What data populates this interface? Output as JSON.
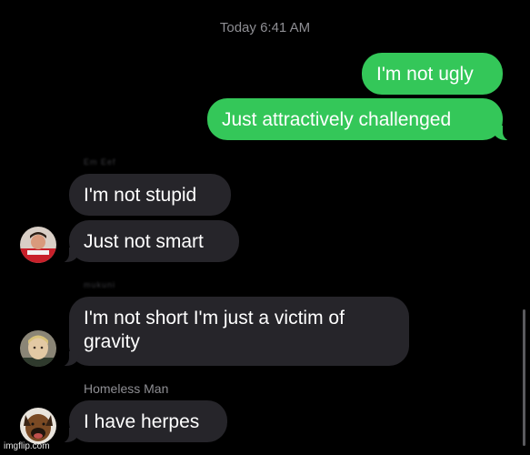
{
  "header": {
    "timestamp": "Today 6:41 AM"
  },
  "messages": {
    "sent_1": "I'm not ugly",
    "sent_2": "Just attractively challenged",
    "recv_1": "I'm not stupid",
    "recv_2": "Just not smart",
    "recv_3_line1": "I'm not short I'm just a victim of",
    "recv_3_line2": "gravity",
    "recv_4": "I have herpes"
  },
  "senders": {
    "group1": "Em  Eef",
    "group2": "mukuni",
    "group3": "Homeless Man"
  },
  "avatars": {
    "avatar1": "red-shirt-person-avatar",
    "avatar2": "blonde-person-avatar",
    "avatar3": "dog-avatar"
  },
  "watermark": "imgflip.com",
  "colors": {
    "background": "#000000",
    "sent_bubble": "#34c759",
    "received_bubble": "#26252a",
    "secondary_text": "#8e8e93"
  }
}
